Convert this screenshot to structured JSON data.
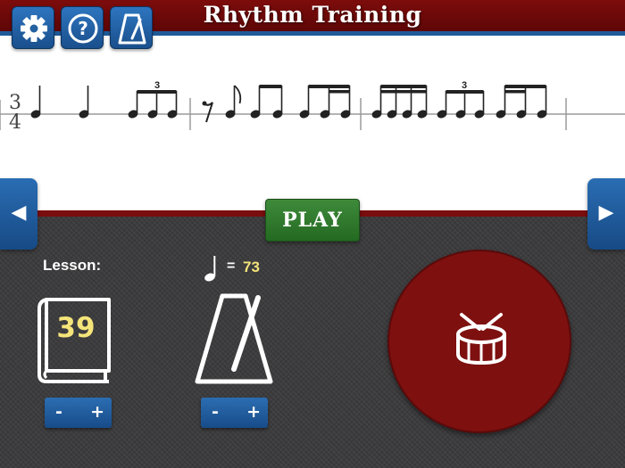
{
  "header": {
    "title": "Rhythm Training",
    "buttons": [
      {
        "icon": "gear-icon"
      },
      {
        "icon": "help-icon",
        "glyph": "?"
      },
      {
        "icon": "metronome-icon"
      }
    ]
  },
  "staff": {
    "time_signature": {
      "top": "3",
      "bottom": "4"
    },
    "tuplet_label": "3"
  },
  "navigation": {
    "prev_glyph": "◀",
    "next_glyph": "▶"
  },
  "play_button": {
    "label": "PLAY"
  },
  "lesson": {
    "label": "Lesson:",
    "number": "39",
    "stepper": {
      "minus": "-",
      "plus": "+"
    }
  },
  "tempo": {
    "equals": "=",
    "bpm": "73",
    "stepper": {
      "minus": "-",
      "plus": "+"
    }
  },
  "drum": {
    "icon": "drum-icon"
  },
  "colors": {
    "header_red": "#7d0c0c",
    "accent_blue": "#1f5a99",
    "play_green": "#2e7a2b",
    "drum_red": "#7e1010",
    "highlight_yellow": "#f5e47a"
  }
}
